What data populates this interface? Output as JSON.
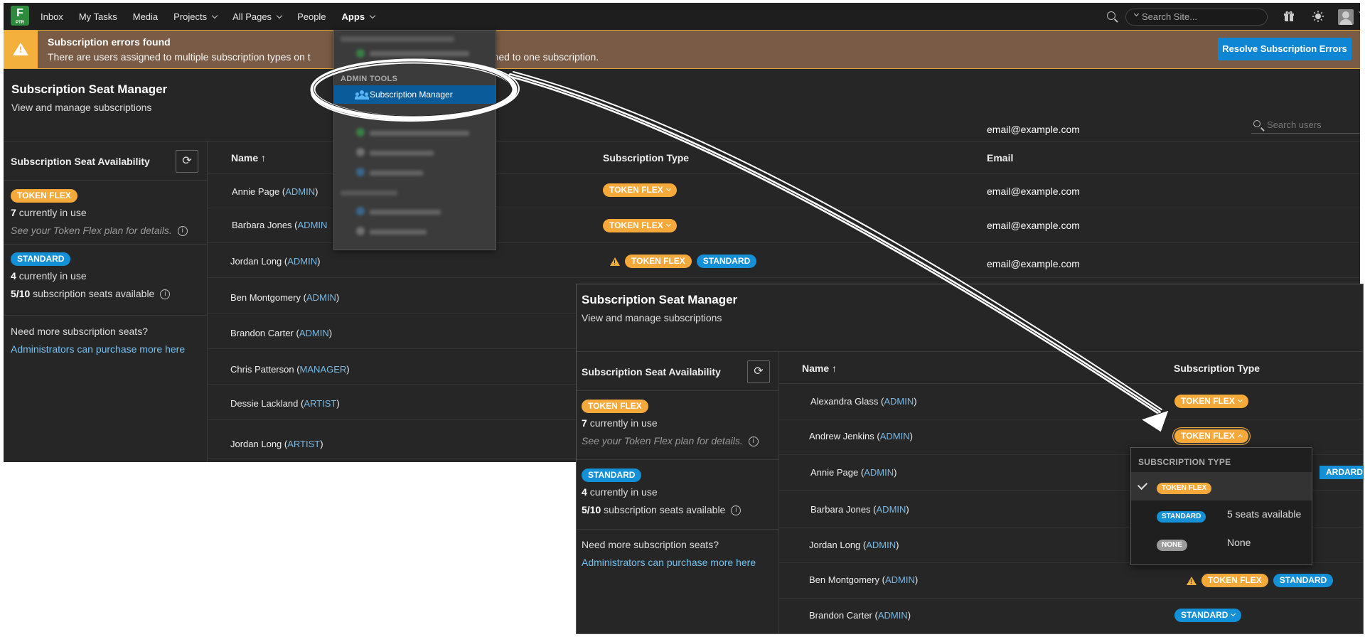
{
  "window1": {
    "logo": {
      "letter": "F",
      "sub": "PTR"
    },
    "nav": [
      "Inbox",
      "My Tasks",
      "Media",
      "Projects",
      "All Pages",
      "People",
      "Apps"
    ],
    "search_site_placeholder": "Search Site...",
    "banner": {
      "title": "Subscription errors found",
      "text_left": "There are users assigned to multiple subscription types on t",
      "text_right": "ssigned to one subscription.",
      "button": "Resolve Subscription Errors"
    },
    "page_title": "Subscription Seat Manager",
    "page_subtitle": "View and manage subscriptions",
    "email_floating": "email@example.com",
    "search_users_placeholder": "Search users",
    "sidebar": {
      "title": "Subscription Seat Availability",
      "token_flex_pill": "TOKEN FLEX",
      "token_flex_count": "7",
      "token_flex_count_text": "currently in use",
      "token_flex_note": "See your Token Flex plan for details.",
      "standard_pill": "STANDARD",
      "standard_count": "4",
      "standard_count_text": "currently in use",
      "standard_avail_num": "5/10",
      "standard_avail_text": "subscription seats available",
      "need_more": "Need more subscription seats?",
      "purchase_link": "Administrators can purchase more here"
    },
    "table": {
      "col_name": "Name",
      "col_sub": "Subscription Type",
      "col_email": "Email",
      "rows": [
        {
          "name": "Annie Page",
          "role": "ADMIN",
          "email": "email@example.com"
        },
        {
          "name": "Barbara Jones",
          "role": "ADMIN",
          "email": "email@example.com"
        },
        {
          "name": "Jordan Long",
          "role": "ADMIN",
          "email": "email@example.com"
        },
        {
          "name": "Ben Montgomery",
          "role": "ADMIN",
          "email": ""
        },
        {
          "name": "Brandon Carter",
          "role": "ADMIN",
          "email": ""
        },
        {
          "name": "Chris Patterson",
          "role": "MANAGER",
          "email": ""
        },
        {
          "name": "Dessie Lackland",
          "role": "ARTIST",
          "email": ""
        },
        {
          "name": "Jordan Long",
          "role": "ARTIST",
          "email": ""
        }
      ]
    },
    "apps_menu": {
      "admin_heading": "ADMIN TOOLS",
      "selected_item": "Subscription Manager"
    }
  },
  "window2": {
    "page_title": "Subscription Seat Manager",
    "page_subtitle": "View and manage subscriptions",
    "sidebar": {
      "title": "Subscription Seat Availability",
      "token_flex_pill": "TOKEN FLEX",
      "token_flex_count": "7",
      "token_flex_count_text": "currently in use",
      "token_flex_note": "See your Token Flex plan for details.",
      "standard_pill": "STANDARD",
      "standard_count": "4",
      "standard_count_text": "currently in use",
      "standard_avail_num": "5/10",
      "standard_avail_text": "subscription seats available",
      "need_more": "Need more subscription seats?",
      "purchase_link": "Administrators can purchase more here"
    },
    "table": {
      "col_name": "Name",
      "col_sub": "Subscription Type",
      "rows": [
        {
          "name": "Alexandra Glass",
          "role": "ADMIN"
        },
        {
          "name": "Andrew Jenkins",
          "role": "ADMIN"
        },
        {
          "name": "Annie Page",
          "role": "ADMIN"
        },
        {
          "name": "Barbara Jones",
          "role": "ADMIN"
        },
        {
          "name": "Jordan Long",
          "role": "ADMIN"
        },
        {
          "name": "Ben Montgomery",
          "role": "ADMIN"
        },
        {
          "name": "Brandon Carter",
          "role": "ADMIN"
        }
      ]
    },
    "popup": {
      "heading": "SUBSCRIPTION TYPE",
      "options": [
        {
          "pill": "TOKEN FLEX",
          "label": ""
        },
        {
          "pill": "STANDARD",
          "label": "5 seats available"
        },
        {
          "pill": "NONE",
          "label": "None"
        }
      ]
    }
  },
  "pills": {
    "token_flex": "TOKEN FLEX",
    "standard": "STANDARD",
    "standard_partial": "ARDARD",
    "standard_partial2": "ARD"
  },
  "colors": {
    "token_flex": "#f6a93b",
    "standard": "#1390d6",
    "accent_button": "#0e86d4",
    "banner_bg": "#7a5c46",
    "warning": "#f3b03c"
  }
}
